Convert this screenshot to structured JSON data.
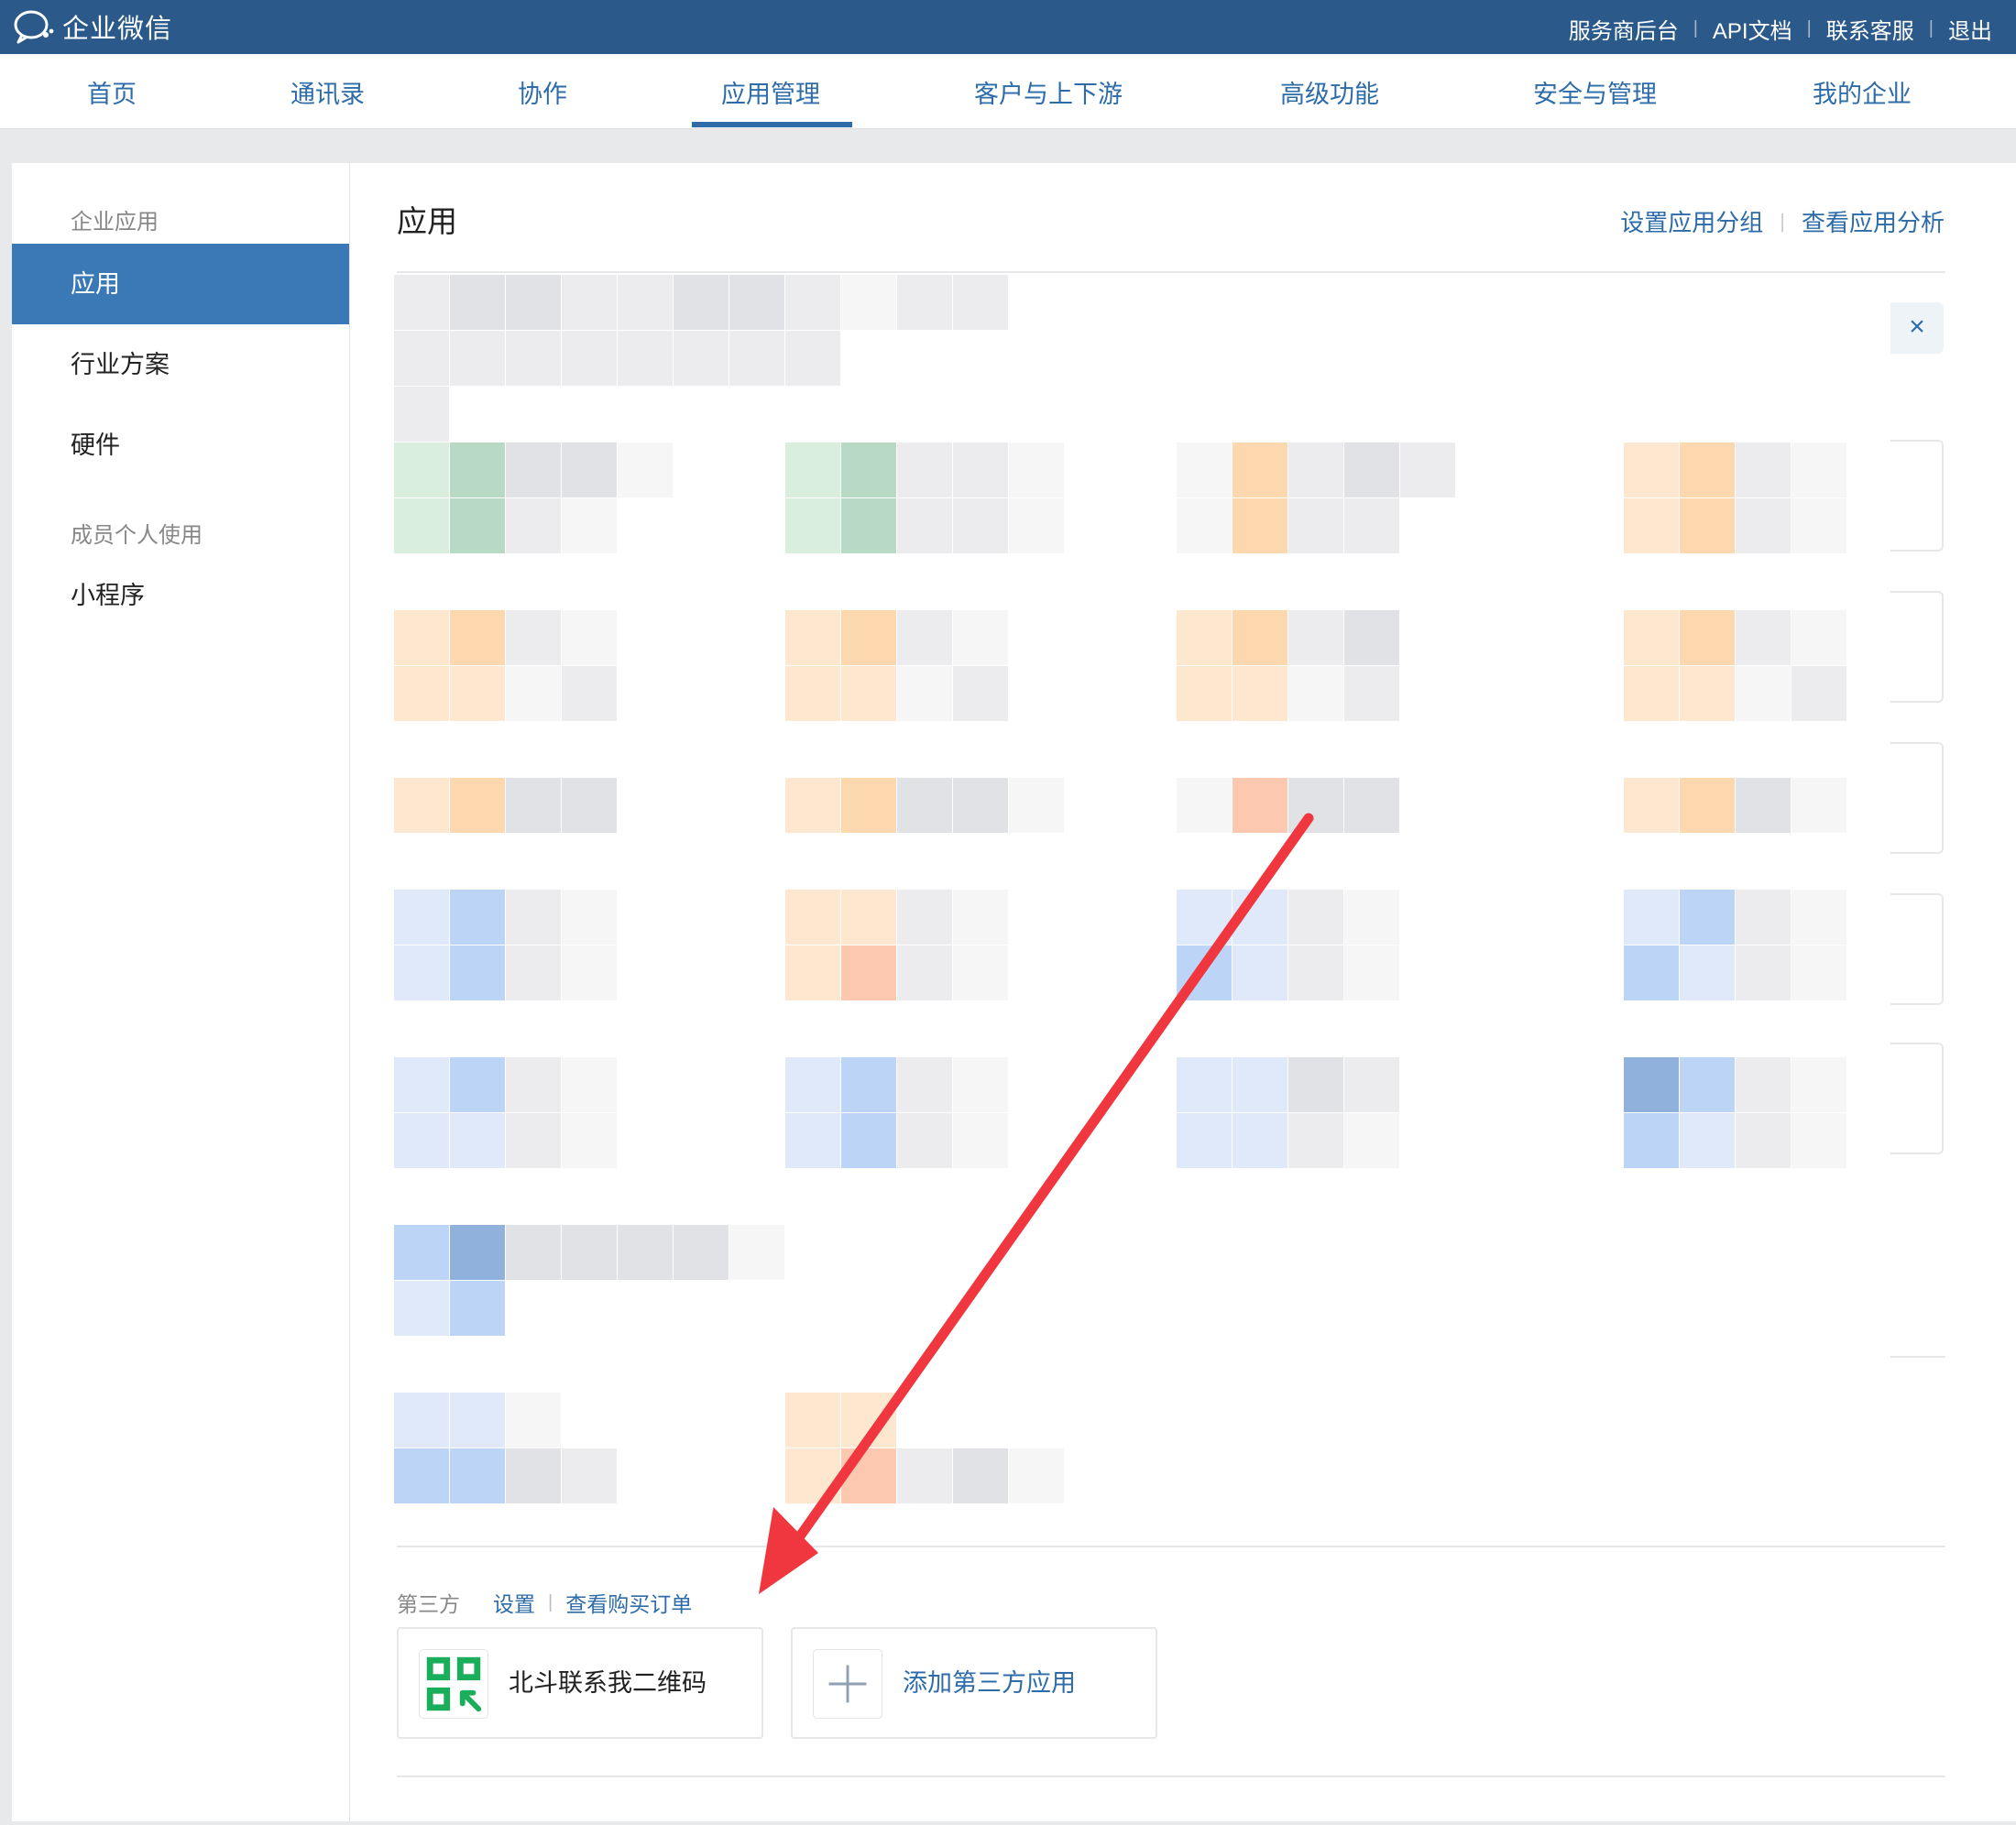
{
  "topbar": {
    "logo_text": "企业微信",
    "links": [
      "服务商后台",
      "API文档",
      "联系客服",
      "退出"
    ],
    "separator": "|",
    "bg_color": "#2b5a8a"
  },
  "nav": {
    "tabs": [
      "首页",
      "通讯录",
      "协作",
      "应用管理",
      "客户与上下游",
      "高级功能",
      "安全与管理",
      "我的企业"
    ],
    "active": "应用管理"
  },
  "sidebar": {
    "section1": "企业应用",
    "items1": [
      "应用",
      "行业方案",
      "硬件"
    ],
    "section2": "成员个人使用",
    "items2": [
      "小程序"
    ],
    "active_color": "#3a78b6"
  },
  "content": {
    "title": "应用",
    "link_groups": "设置应用分组",
    "link_analysis": "查看应用分析",
    "close_glyph": "×",
    "third_party": {
      "label": "第三方",
      "settings": "设置",
      "orders": "查看购买订单",
      "apps": [
        {
          "name": "北斗联系我二维码",
          "icon": "qr-code-icon"
        },
        {
          "name": "添加第三方应用",
          "icon": "plus-icon"
        }
      ]
    }
  },
  "accent_color": "#2d6ca8",
  "annotation_color": "#f0363f"
}
